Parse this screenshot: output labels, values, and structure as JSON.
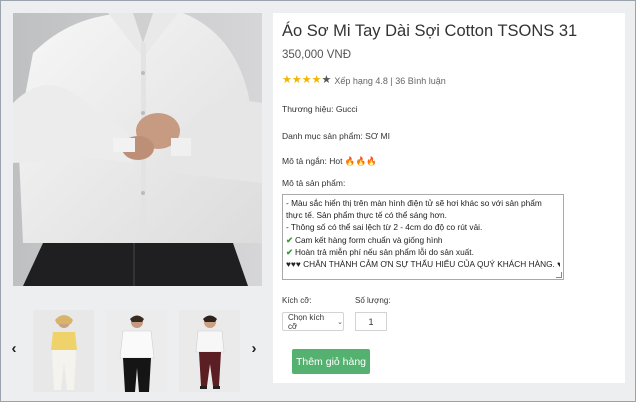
{
  "product": {
    "title": "Áo Sơ Mi Tay Dài Sợi Cotton TSONS 31",
    "price": "350,000 VNĐ",
    "rating": {
      "stars": 4,
      "max": 5,
      "text": "Xếp hạng 4.8 | 36 Bình luận"
    },
    "brand_label": "Thương hiệu:",
    "brand": "Gucci",
    "category_label": "Danh mục sản phẩm:",
    "category": "SƠ MI",
    "short_desc_label": "Mô tả ngắn:",
    "short_desc": "Hot 🔥🔥🔥",
    "desc_label": "Mô tả sản phẩm:",
    "desc_lines": [
      "- Màu sắc hiển thị trên màn hình điện tử sẽ hơi khác so với sản phẩm thực tế. Sản phẩm thực tế có thể sáng hơn.",
      "- Thông số có thể sai lệch từ 2 - 4cm do độ co rút vải.",
      "Cam kết hàng form chuẩn và giống hình",
      "Hoàn trả miễn phí nếu sản phẩm lỗi do sản xuất.",
      "♥♥♥ CHÂN THÀNH CẢM ƠN SỰ THẤU HIỂU CỦA QUÝ KHÁCH HÀNG. ♥♥♥"
    ],
    "check_glyph": "✔",
    "size_label": "Kích cỡ:",
    "size_placeholder": "Chọn kích cỡ",
    "qty_label": "Số lượng:",
    "qty_value": "1",
    "add_to_cart": "Thêm giỏ hàng"
  },
  "gallery": {
    "prev_icon": "‹",
    "next_icon": "›",
    "thumbs": [
      "thumb-yellow-top",
      "thumb-white-shirt",
      "thumb-white-red-pants"
    ]
  },
  "colors": {
    "accent": "#55b16f",
    "star": "#f4b400",
    "check": "#3a9b3a"
  }
}
